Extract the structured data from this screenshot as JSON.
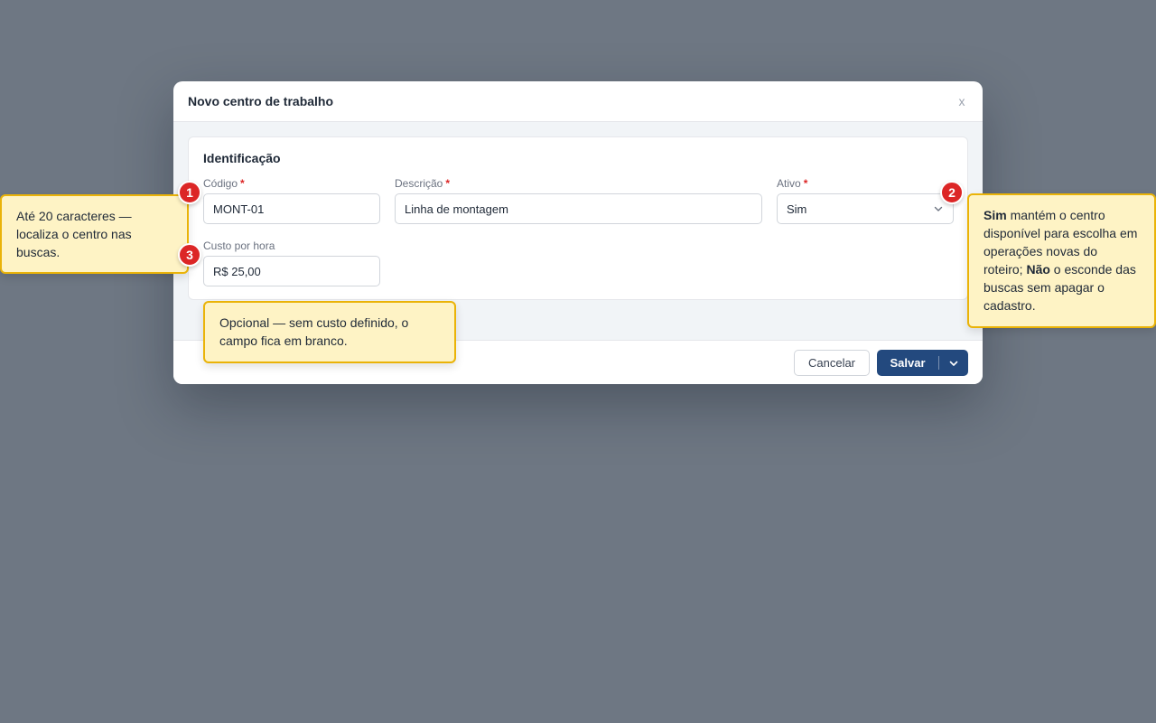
{
  "modal": {
    "title": "Novo centro de trabalho",
    "close_label": "x",
    "section_title": "Identificação",
    "fields": {
      "code": {
        "label": "Código",
        "required": "*",
        "value": "MONT-01"
      },
      "description": {
        "label": "Descrição",
        "required": "*",
        "value": "Linha de montagem"
      },
      "active": {
        "label": "Ativo",
        "required": "*",
        "value": "Sim"
      },
      "cost": {
        "label": "Custo por hora",
        "value": "R$ 25,00"
      }
    },
    "footer": {
      "cancel_label": "Cancelar",
      "save_label": "Salvar"
    }
  },
  "callouts": {
    "c1": {
      "number": "1",
      "text": "Até 20 caracteres — localiza o centro nas buscas."
    },
    "c2": {
      "number": "2",
      "sim": "Sim",
      "text_a": " mantém o centro disponível para escolha em operações novas do roteiro; ",
      "nao": "Não",
      "text_b": " o esconde das buscas sem apagar o cadastro."
    },
    "c3": {
      "number": "3",
      "text": "Opcional — sem custo definido, o campo fica em branco."
    }
  },
  "colors": {
    "backdrop": "#6e7783",
    "primary": "#23497e",
    "required": "#dc2626",
    "callout_bg": "#fef3c5",
    "callout_border": "#eab308",
    "badge": "#dc2626"
  },
  "icons": [
    "close-icon",
    "chevron-down-icon"
  ]
}
